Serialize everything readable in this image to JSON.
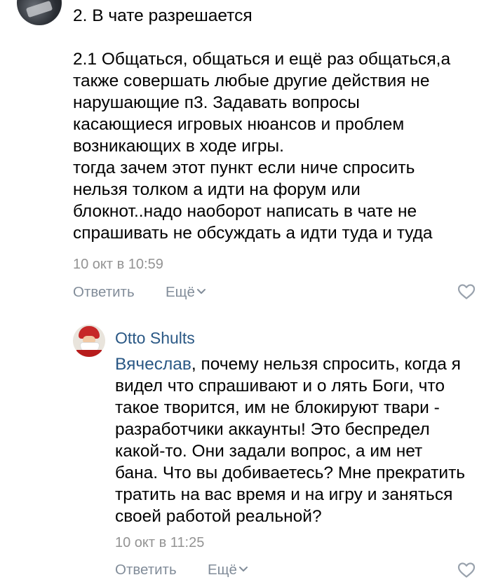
{
  "comment1": {
    "avatar_icon": "user-avatar-dark",
    "lines": [
      "2. В чате разрешается",
      "",
      "2.1 Общаться, общаться и ещё раз общаться,а",
      "также совершать любые другие действия не",
      "нарушающие п3. Задавать вопросы",
      "касающиеся игровых нюансов и проблем",
      "возникающих в ходе игры.",
      "тогда зачем этот пункт если ниче спросить",
      "нельзя толком а идти на форум или",
      "блокнот..надо наоборот написать в чате не",
      "спрашивать не обсуждать а идти туда и туда"
    ],
    "time": "10 окт в 10:59",
    "reply_label": "Ответить",
    "more_label": "Ещё"
  },
  "comment2": {
    "author": "Otto Shults",
    "avatar_icon": "user-avatar-santa",
    "mention": "Вячеслав",
    "first_line_rest": ", почему нельзя спросить, когда я",
    "lines": [
      "видел что спрашивают и о лять Боги, что",
      "такое творится, им не блокируют твари -",
      "разработчики аккаунты! Это беспредел",
      "какой-то. Они задали вопрос, а им нет",
      "бана. Что вы добиваетесь? Мне прекратить",
      "тратить на вас время и на игру и заняться",
      "своей работой реальной?"
    ],
    "time": "10 окт в 11:25",
    "reply_label": "Ответить",
    "more_label": "Ещё"
  },
  "colors": {
    "link": "#2a5885",
    "meta": "#939393",
    "action": "#818c99"
  }
}
